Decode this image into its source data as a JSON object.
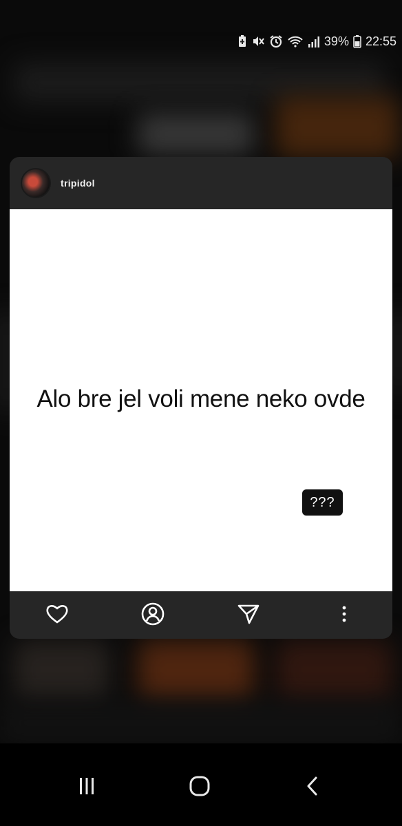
{
  "status_bar": {
    "battery_percent": "39%",
    "time": "22:55",
    "icons": [
      "battery-saver-icon",
      "vibrate-mute-icon",
      "alarm-icon",
      "wifi-icon",
      "signal-icon",
      "battery-icon"
    ]
  },
  "post": {
    "username": "tripidol",
    "text": "Alo bre jel voli mene neko ovde",
    "badge": "???"
  },
  "toolbar": {
    "icons": [
      "heart-icon",
      "profile-icon",
      "send-icon",
      "more-vertical-icon"
    ]
  },
  "navbar": {
    "icons": [
      "recents-icon",
      "home-icon",
      "back-icon"
    ]
  }
}
